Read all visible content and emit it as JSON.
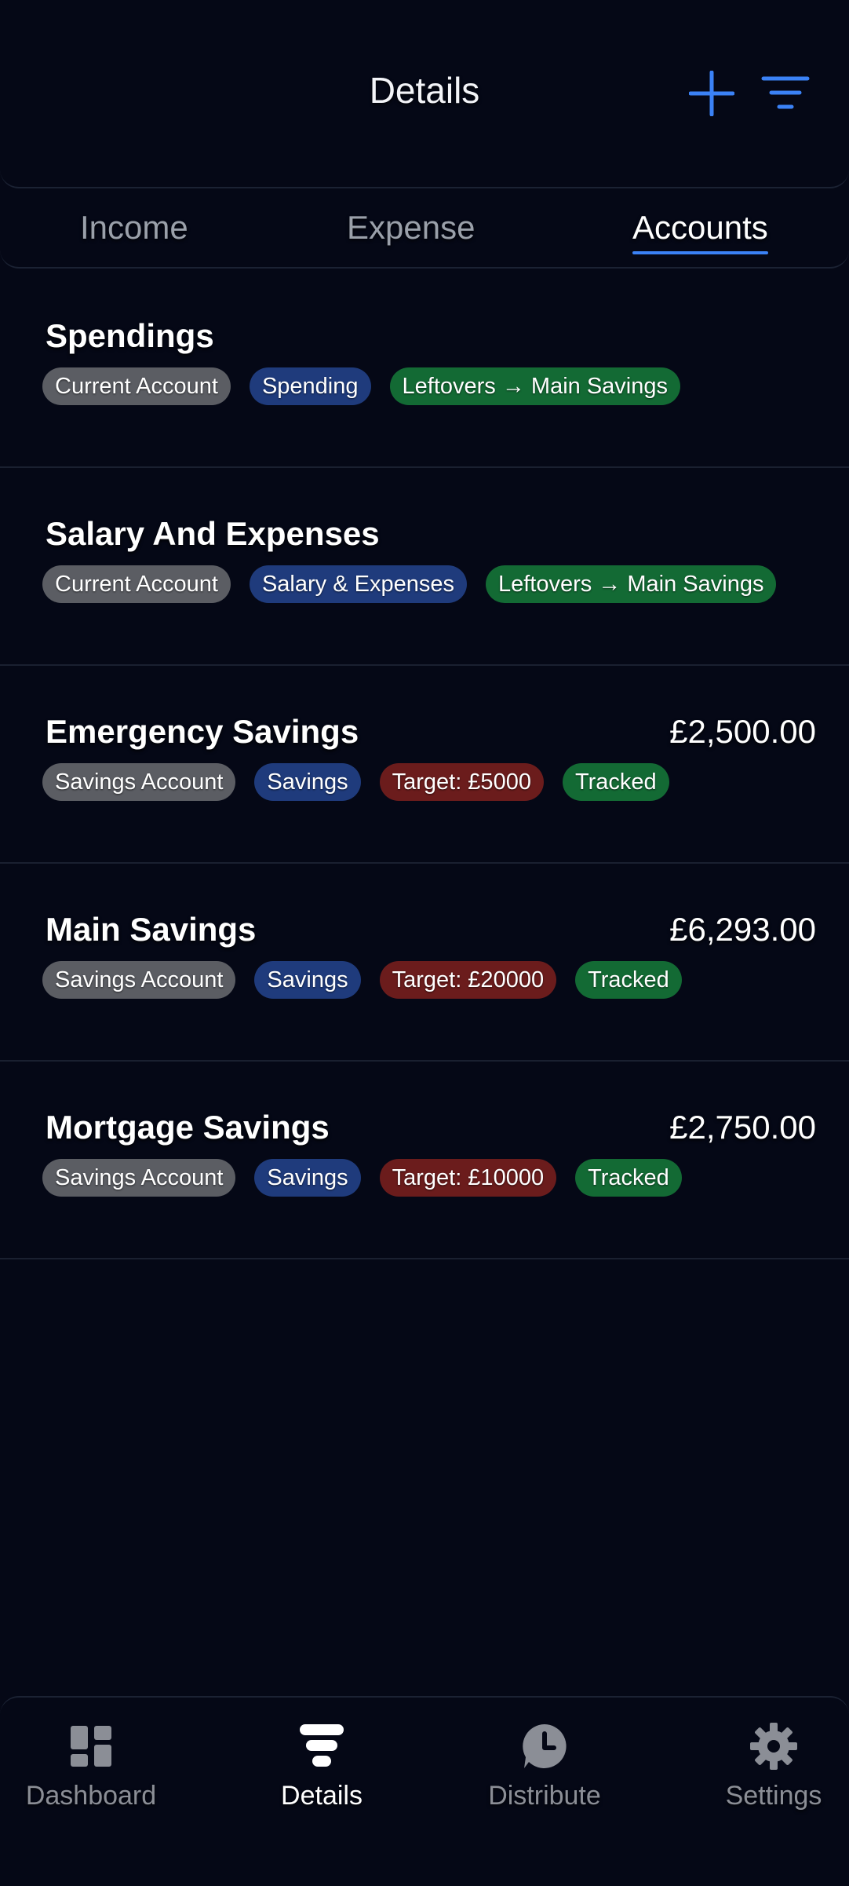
{
  "header": {
    "title": "Details",
    "add_icon": "plus-icon",
    "filter_icon": "filter-icon",
    "accent_color": "#3b82f6"
  },
  "tabs": [
    {
      "label": "Income",
      "active": false
    },
    {
      "label": "Expense",
      "active": false
    },
    {
      "label": "Accounts",
      "active": true
    }
  ],
  "accounts": [
    {
      "name": "Spendings",
      "amount": "",
      "tags": [
        "Current Account",
        "Spending",
        "Leftovers → Main Savings"
      ]
    },
    {
      "name": "Salary And Expenses",
      "amount": "",
      "tags": [
        "Current Account",
        "Salary & Expenses",
        "Leftovers → Main Savings"
      ]
    },
    {
      "name": "Emergency Savings",
      "amount": "£2,500.00",
      "tags": [
        "Savings Account",
        "Savings",
        "Target: £5000",
        "Tracked"
      ]
    },
    {
      "name": "Main Savings",
      "amount": "£6,293.00",
      "tags": [
        "Savings Account",
        "Savings",
        "Target: £20000",
        "Tracked"
      ]
    },
    {
      "name": "Mortgage Savings",
      "amount": "£2,750.00",
      "tags": [
        "Savings Account",
        "Savings",
        "Target: £10000",
        "Tracked"
      ]
    }
  ],
  "tag_colors": {
    "account_type": "#5b5d63",
    "category": "#1f3b7c",
    "leftovers": "#136a34",
    "target": "#6b1c1c",
    "tracked": "#136a34"
  },
  "nav": [
    {
      "label": "Dashboard",
      "icon": "dashboard-icon",
      "active": false
    },
    {
      "label": "Details",
      "icon": "details-icon",
      "active": true
    },
    {
      "label": "Distribute",
      "icon": "distribute-icon",
      "active": false
    },
    {
      "label": "Settings",
      "icon": "settings-icon",
      "active": false
    }
  ]
}
